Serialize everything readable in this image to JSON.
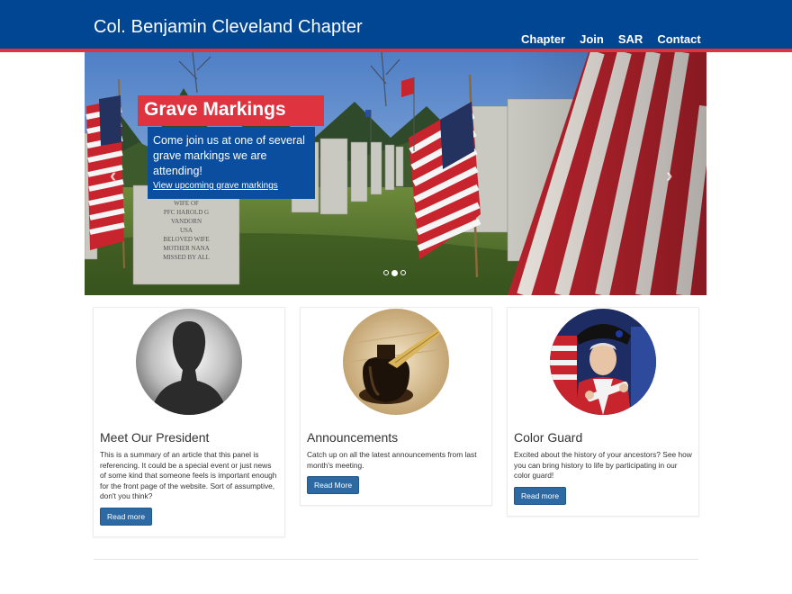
{
  "site": {
    "title": "Col. Benjamin Cleveland Chapter",
    "colors": {
      "header": "#004693",
      "stripe": "#e03340",
      "caption_title_bg": "#e03340",
      "caption_box_bg": "#0b4d9e",
      "button": "#2d6aa3"
    }
  },
  "nav": {
    "items": [
      {
        "label": "Chapter"
      },
      {
        "label": "Join"
      },
      {
        "label": "SAR"
      },
      {
        "label": "Contact"
      }
    ]
  },
  "carousel": {
    "slide": {
      "title": "Grave Markings",
      "text": "Come join us at one of several grave markings we are attending!",
      "link": "View upcoming grave markings",
      "image": "cemetery-flags-photo"
    },
    "prev_icon": "‹",
    "next_icon": "›",
    "indicator_count": 3,
    "active_index": 1
  },
  "panels": [
    {
      "title": "Meet Our President",
      "text": "This is a summary of an article that this panel is referencing. It could be a special event or just news of some kind that someone feels is important enough for the front page of the website. Sort of assumptive, don't you think?",
      "button": "Read more",
      "image": "person-silhouette-icon"
    },
    {
      "title": "Announcements",
      "text": "Catch up on all the latest announcements from last month's meeting.",
      "button": "Read More",
      "image": "inkwell-quill-photo"
    },
    {
      "title": "Color Guard",
      "text": "Excited about the history of your ancestors? See how you can bring history to life by participating in our color guard!",
      "button": "Read more",
      "image": "color-guard-soldier-photo"
    }
  ]
}
